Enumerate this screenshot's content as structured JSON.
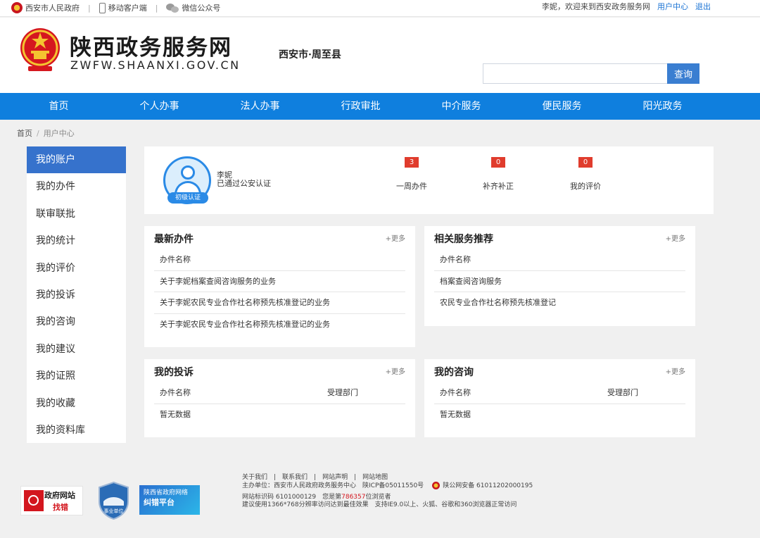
{
  "topbar": {
    "gov_link": "西安市人民政府",
    "mobile": "移动客户端",
    "wechat": "微信公众号",
    "welcome": "李妮，欢迎来到西安政务服务网",
    "user_center": "用户中心",
    "logout": "退出"
  },
  "header": {
    "site_name": "陕西政务服务网",
    "domain": "ZWFW.SHAANXI.GOV.CN",
    "region": "西安市·周至县",
    "search_placeholder": "",
    "search_button": "查询"
  },
  "nav": [
    "首页",
    "个人办事",
    "法人办事",
    "行政审批",
    "中介服务",
    "便民服务",
    "阳光政务"
  ],
  "breadcrumb": {
    "home": "首页",
    "current": "用户中心"
  },
  "sidebar": {
    "items": [
      "我的账户",
      "我的办件",
      "联审联批",
      "我的统计",
      "我的评价",
      "我的投诉",
      "我的咨询",
      "我的建议",
      "我的证照",
      "我的收藏",
      "我的资料库"
    ],
    "active": "我的账户"
  },
  "profile": {
    "name": "李妮",
    "status": "已通过公安认证",
    "badge": "初级认证",
    "stats": [
      {
        "count": "3",
        "label": "一周办件"
      },
      {
        "count": "0",
        "label": "补齐补正"
      },
      {
        "count": "0",
        "label": "我的评价"
      }
    ]
  },
  "panels": {
    "latest": {
      "title": "最新办件",
      "more": "+更多",
      "header": "办件名称",
      "rows": [
        "关于李妮档案查阅咨询服务的业务",
        "关于李妮农民专业合作社名称预先核准登记的业务",
        "关于李妮农民专业合作社名称预先核准登记的业务"
      ]
    },
    "related": {
      "title": "相关服务推荐",
      "more": "+更多",
      "header": "办件名称",
      "rows": [
        "档案查阅咨询服务",
        "农民专业合作社名称预先核准登记"
      ]
    },
    "complaints": {
      "title": "我的投诉",
      "more": "+更多",
      "col1": "办件名称",
      "col2": "受理部门",
      "empty": "暂无数据"
    },
    "consult": {
      "title": "我的咨询",
      "more": "+更多",
      "col1": "办件名称",
      "col2": "受理部门",
      "empty": "暂无数据"
    }
  },
  "footer": {
    "gov_find_1": "政府网站",
    "gov_find_2": "找错",
    "shield_text": "事业单位",
    "platform_1": "陕西省政府网络",
    "platform_2": "纠错平台",
    "links": "关于我们　|　联系我们　|　网站声明　|　网站地图",
    "host": "主办单位：西安市人民政府政务服务中心　陕ICP备05011550号",
    "police": "陕公网安备 61011202000195",
    "code_prefix": "网站标识码 6101000129　您是第",
    "visits": "786357",
    "code_suffix": "位浏览者",
    "advice": "建议使用1366*768分辨率访问达到最佳效果　支持IE9.0以上、火狐、谷歌和360浏览器正常访问"
  }
}
